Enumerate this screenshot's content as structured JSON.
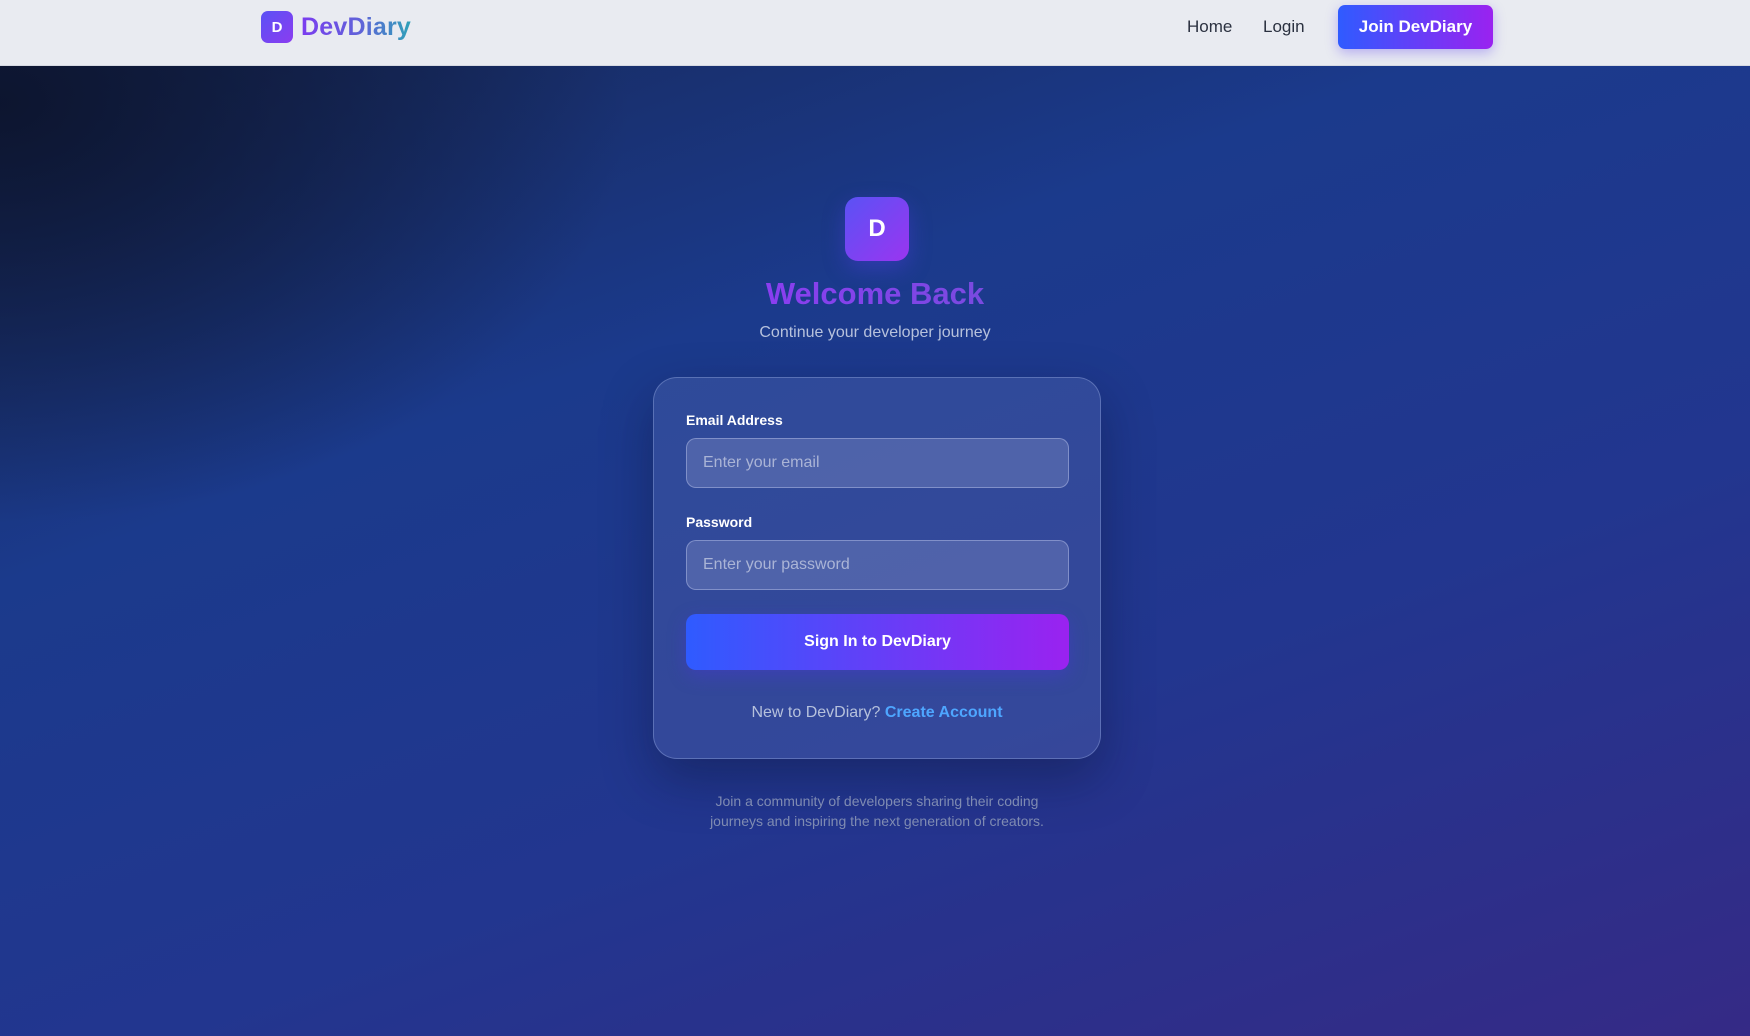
{
  "nav": {
    "brand_initial": "D",
    "brand_name": "DevDiary",
    "home_label": "Home",
    "login_label": "Login",
    "join_label": "Join DevDiary"
  },
  "hero": {
    "badge_initial": "D",
    "title": "Welcome Back",
    "subtitle": "Continue your developer journey"
  },
  "form": {
    "email_label": "Email Address",
    "email_placeholder": "Enter your email",
    "password_label": "Password",
    "password_placeholder": "Enter your password",
    "submit_label": "Sign In to DevDiary",
    "signup_prompt": "New to DevDiary?",
    "signup_link": "Create Account"
  },
  "footer": {
    "note_line1": "Join a community of developers sharing their coding",
    "note_line2": "journeys and inspiring the next generation of creators."
  },
  "colors": {
    "accent_start": "#2f5bff",
    "accent_end": "#9a22f0",
    "link": "#4ea6ff",
    "header_bg": "#e9ebf1"
  },
  "icons": {
    "brand_logo": "letter-d-badge",
    "hero_logo": "letter-d-badge"
  }
}
